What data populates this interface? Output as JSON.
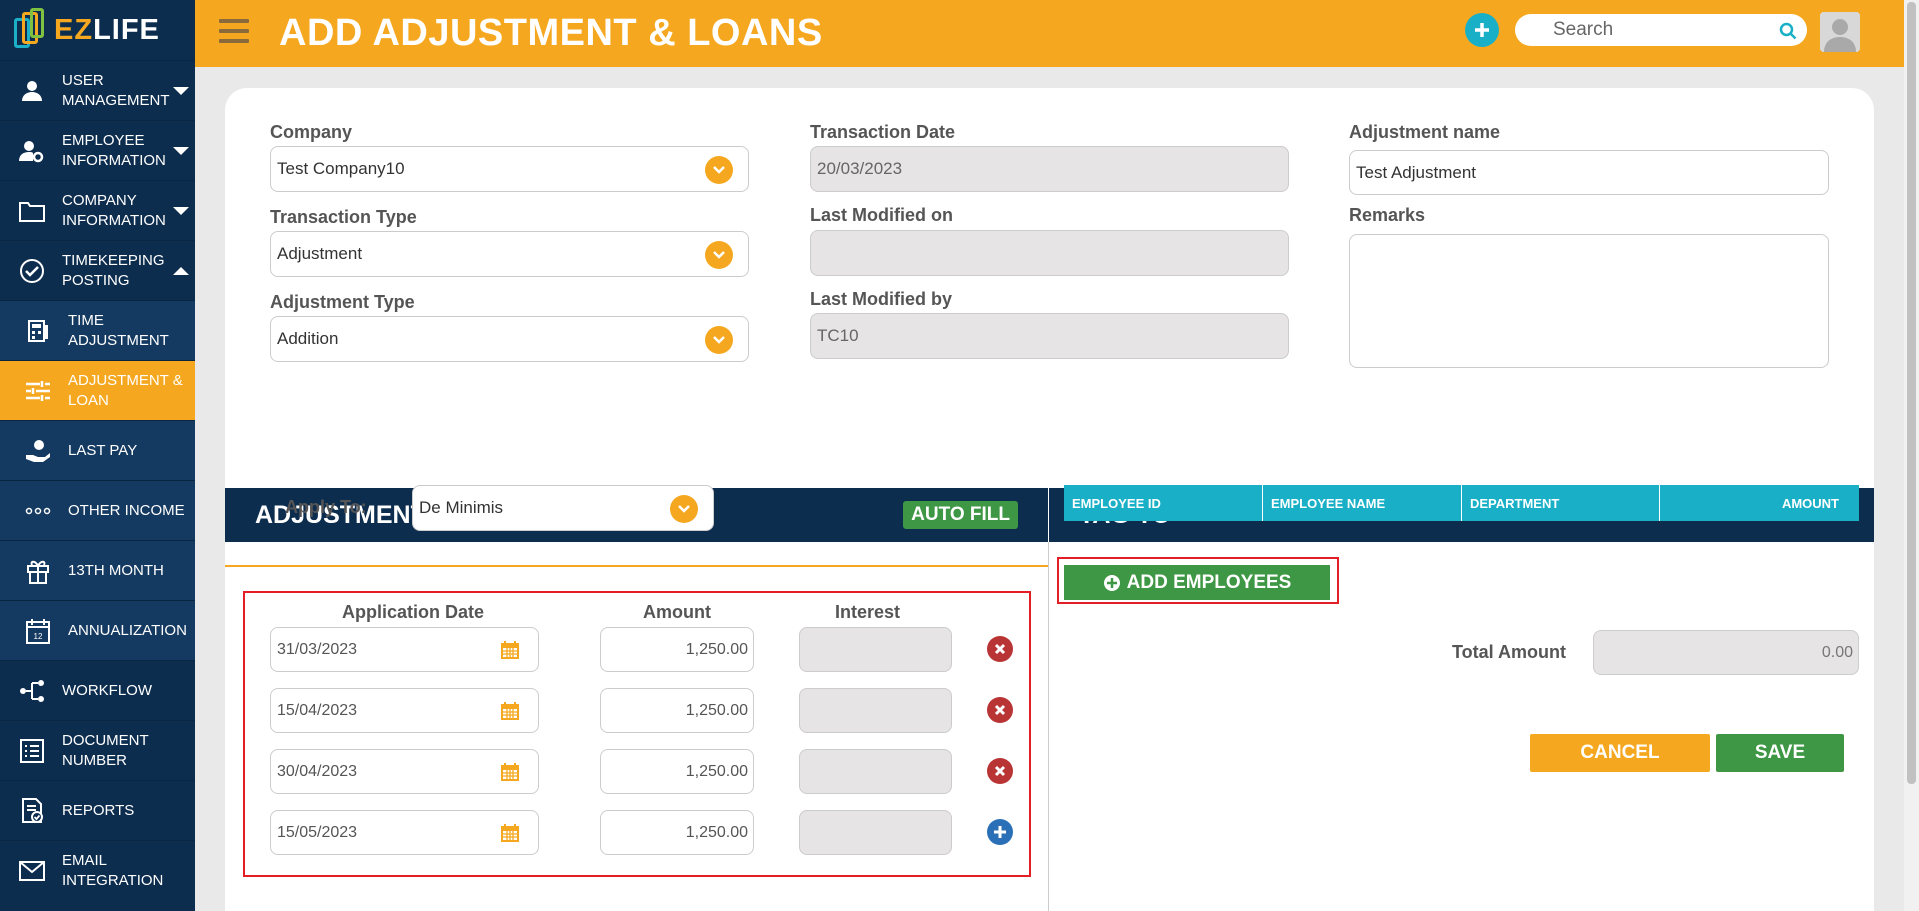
{
  "app": {
    "logo_prefix": "EZ",
    "logo_suffix": "LIFE",
    "colors": {
      "navy": "#0d2d4f",
      "orange": "#f5a81f",
      "teal": "#19b0c7",
      "green": "#3e9744",
      "red": "#e31e24"
    }
  },
  "sidebar": {
    "items": [
      {
        "label": "USER MANAGEMENT",
        "icon": "user-icon"
      },
      {
        "label": "EMPLOYEE INFORMATION",
        "icon": "user-gear-icon"
      },
      {
        "label": "COMPANY INFORMATION",
        "icon": "folder-icon"
      },
      {
        "label": "TIMEKEEPING POSTING",
        "icon": "check-circle-icon"
      },
      {
        "label": "TIME ADJUSTMENT",
        "icon": "calculator-icon"
      },
      {
        "label": "ADJUSTMENT & LOAN",
        "icon": "sliders-icon"
      },
      {
        "label": "LAST PAY",
        "icon": "hand-coin-icon"
      },
      {
        "label": "OTHER INCOME",
        "icon": "dots-icon"
      },
      {
        "label": "13TH MONTH",
        "icon": "gift-icon"
      },
      {
        "label": "ANNUALIZATION",
        "icon": "calendar-icon"
      },
      {
        "label": "WORKFLOW",
        "icon": "workflow-icon"
      },
      {
        "label": "DOCUMENT NUMBER",
        "icon": "document-list-icon"
      },
      {
        "label": "REPORTS",
        "icon": "report-icon"
      },
      {
        "label": "EMAIL INTEGRATION",
        "icon": "mail-icon"
      }
    ]
  },
  "header": {
    "title": "ADD ADJUSTMENT & LOANS",
    "search_placeholder": "Search"
  },
  "form": {
    "company_label": "Company",
    "company_value": "Test Company10",
    "transaction_type_label": "Transaction Type",
    "transaction_type_value": "Adjustment",
    "adjustment_type_label": "Adjustment Type",
    "adjustment_type_value": "Addition",
    "transaction_date_label": "Transaction Date",
    "transaction_date_value": "20/03/2023",
    "last_modified_on_label": "Last Modified on",
    "last_modified_on_value": "",
    "last_modified_by_label": "Last Modified by",
    "last_modified_by_value": "TC10",
    "adjustment_name_label": "Adjustment name",
    "adjustment_name_value": "Test Adjustment",
    "remarks_label": "Remarks",
    "remarks_value": ""
  },
  "adjustment_details": {
    "title": "ADJUSTMENT DETAILS",
    "auto_fill_label": "AUTO FILL",
    "apply_to_label": "Apply To:",
    "apply_to_value": "De Minimis",
    "col_application_date": "Application Date",
    "col_amount": "Amount",
    "col_interest": "Interest",
    "rows": [
      {
        "date": "31/03/2023",
        "amount": "1,250.00",
        "interest": ""
      },
      {
        "date": "15/04/2023",
        "amount": "1,250.00",
        "interest": ""
      },
      {
        "date": "30/04/2023",
        "amount": "1,250.00",
        "interest": ""
      },
      {
        "date": "15/05/2023",
        "amount": "1,250.00",
        "interest": ""
      }
    ]
  },
  "tag_to": {
    "title": "TAG TO",
    "columns": [
      "EMPLOYEE ID",
      "EMPLOYEE NAME",
      "DEPARTMENT",
      "AMOUNT"
    ],
    "add_employees_label": "ADD EMPLOYEES",
    "total_amount_label": "Total Amount",
    "total_amount_value": "0.00",
    "cancel_label": "CANCEL",
    "save_label": "SAVE"
  }
}
